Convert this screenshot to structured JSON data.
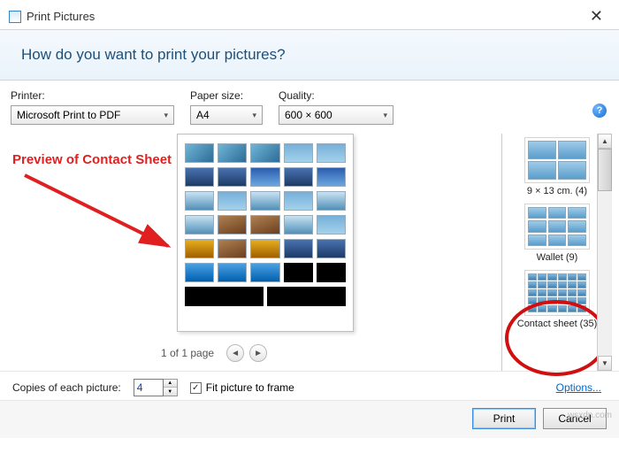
{
  "title": "Print Pictures",
  "banner_question": "How do you want to print your pictures?",
  "controls": {
    "printer_label": "Printer:",
    "printer_value": "Microsoft Print to PDF",
    "paper_label": "Paper size:",
    "paper_value": "A4",
    "quality_label": "Quality:",
    "quality_value": "600 × 600"
  },
  "annotation": "Preview of Contact Sheet",
  "pager": "1 of 1 page",
  "layouts": {
    "l1": "9 × 13 cm. (4)",
    "l2": "Wallet (9)",
    "l3": "Contact sheet (35)"
  },
  "bottom": {
    "copies_label": "Copies of each picture:",
    "copies_value": "4",
    "fit_label": "Fit picture to frame",
    "options_link": "Options...",
    "print": "Print",
    "cancel": "Cancel"
  },
  "help_tip": "?",
  "watermark": "wsxdn.com"
}
